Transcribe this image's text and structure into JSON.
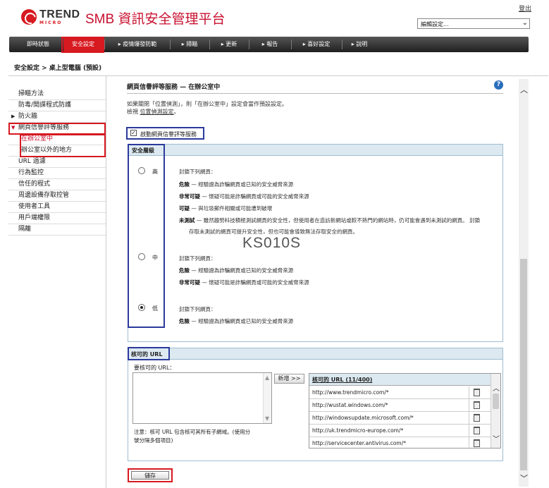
{
  "header": {
    "logo_text": "TREND",
    "logo_sub": "MICRO",
    "app_title": "SMB 資訊安全管理平台",
    "logout": "登出",
    "edit_select": "編輯設定..."
  },
  "nav": {
    "items": [
      "即時狀態",
      "安全設定",
      "▸ 疫情爆發防範",
      "▸ 掃瞄",
      "▸ 更新",
      "▸ 報告",
      "▸ 喜好設定",
      "▸ 說明"
    ],
    "active_index": 1
  },
  "breadcrumb": "安全設定 > 桌上型電腦 (預設)",
  "sidebar": {
    "items": [
      "掃瞄方法",
      "防毒/間諜程式防護",
      "防火牆",
      "網頁信譽評等服務",
      "在辦公室中",
      "辦公室以外的地方",
      "URL 過濾",
      "行為監控",
      "信任的程式",
      "周邊設備存取控管",
      "使用者工具",
      "用戶端權限",
      "隔離"
    ]
  },
  "content": {
    "title": "網頁信譽評等服務 — 在辦公室中",
    "help": "?",
    "desc1": "如果關閉「位置偵測」，則「在辦公室中」設定會當作預設設定。",
    "desc2_prefix": "檢視 ",
    "desc2_link": "位置偵測設定",
    "desc2_suffix": "。",
    "enable_label": "啟動網頁信譽評等服務",
    "enable_checked": true
  },
  "security": {
    "title": "安全層級",
    "levels": [
      {
        "label": "高",
        "selected": false
      },
      {
        "label": "中",
        "selected": false
      },
      {
        "label": "低",
        "selected": true
      }
    ],
    "high": {
      "intro": "封鎖下列網頁：",
      "l1_key": "危險",
      "l1_text": " — 經驗證為詐騙網頁或已知的安全威脅來源",
      "l2_key": "非常可疑",
      "l2_text": " — 懷疑可能是詐騙網頁或可能的安全威脅來源",
      "l3_key": "可疑",
      "l3_text": " — 與垃圾郵件相關或可能遭到破壞",
      "l4_key": "未測試",
      "l4_text": " — 雖然趨勢科技積極測試網頁的安全性，但使用者在造訪新網站或較不熱門的網站時，仍可能會遇到未測試的網頁。 封鎖",
      "l4_text2": "存取未測試的網頁可提升安全性，但也可能會導致無法存取安全的網頁。"
    },
    "medium": {
      "intro": "封鎖下列網頁：",
      "l1_key": "危險",
      "l1_text": " — 經驗證為詐騙網頁或已知的安全威脅來源",
      "l2_key": "非常可疑",
      "l2_text": " — 懷疑可能是詐騙網頁或可能的安全威脅來源"
    },
    "low": {
      "intro": "封鎖下列網頁：",
      "l1_key": "危險",
      "l1_text": " — 經驗證為詐騙網頁或已知的安全威脅來源"
    }
  },
  "watermark": "KS010S",
  "approved": {
    "title": "核可的 URL",
    "input_label": "要核可的 URL：",
    "add_button": "新增 >>",
    "list_header": "核可的 URL (11/400)",
    "urls": [
      "http://www.trendmicro.com/*",
      "http://wustat.windows.com/*",
      "http://windowsupdate.microsoft.com/*",
      "http://uk.trendmicro-europe.com/*",
      "http://servicecenter.antivirus.com/*"
    ],
    "note1": "注意：核可 URL 包含核可其所有子網域。(使用分",
    "note2": "號分隔多個項目)"
  },
  "save_button": "儲存"
}
